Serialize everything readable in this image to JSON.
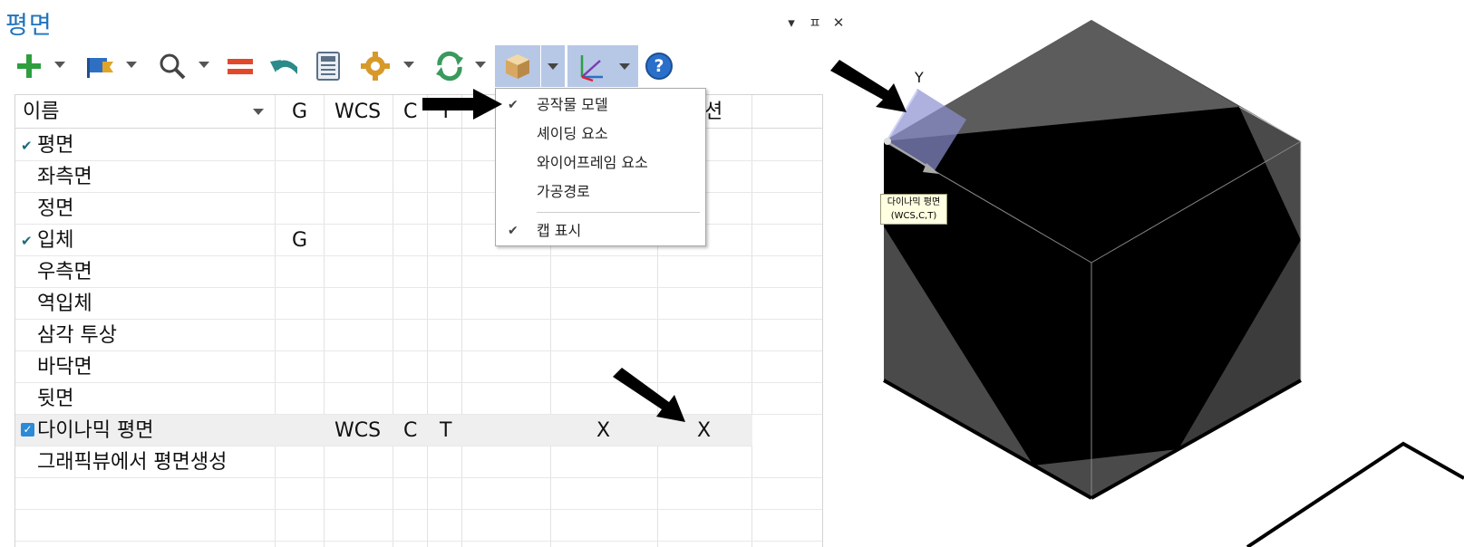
{
  "panel": {
    "title": "평면",
    "controls": {
      "dropdown": "▾",
      "pin": "ㅍ",
      "close": "✕"
    }
  },
  "toolbar": {
    "icons": [
      "add-icon",
      "flag-icon",
      "search-icon",
      "equal-icon",
      "undo-icon",
      "calculator-icon",
      "gear-icon",
      "refresh-icon",
      "cube-icon",
      "axes-icon",
      "help-icon"
    ],
    "help_label": "?"
  },
  "grid": {
    "columns": [
      "이름",
      "G",
      "WCS",
      "C",
      "T",
      "",
      "",
      "션"
    ],
    "rows": [
      {
        "checked": true,
        "checkbox": false,
        "name": "평면",
        "g": "",
        "wcs": "",
        "c": "",
        "t": "",
        "x1": "",
        "x2": ""
      },
      {
        "checked": false,
        "checkbox": false,
        "name": "좌측면",
        "g": "",
        "wcs": "",
        "c": "",
        "t": "",
        "x1": "",
        "x2": ""
      },
      {
        "checked": false,
        "checkbox": false,
        "name": "정면",
        "g": "",
        "wcs": "",
        "c": "",
        "t": "",
        "x1": "",
        "x2": ""
      },
      {
        "checked": true,
        "checkbox": false,
        "name": "입체",
        "g": "G",
        "wcs": "",
        "c": "",
        "t": "",
        "x1": "",
        "x2": ""
      },
      {
        "checked": false,
        "checkbox": false,
        "name": "우측면",
        "g": "",
        "wcs": "",
        "c": "",
        "t": "",
        "x1": "",
        "x2": ""
      },
      {
        "checked": false,
        "checkbox": false,
        "name": "역입체",
        "g": "",
        "wcs": "",
        "c": "",
        "t": "",
        "x1": "",
        "x2": ""
      },
      {
        "checked": false,
        "checkbox": false,
        "name": "삼각 투상",
        "g": "",
        "wcs": "",
        "c": "",
        "t": "",
        "x1": "",
        "x2": ""
      },
      {
        "checked": false,
        "checkbox": false,
        "name": "바닥면",
        "g": "",
        "wcs": "",
        "c": "",
        "t": "",
        "x1": "",
        "x2": ""
      },
      {
        "checked": false,
        "checkbox": false,
        "name": "뒷면",
        "g": "",
        "wcs": "",
        "c": "",
        "t": "",
        "x1": "",
        "x2": ""
      },
      {
        "checked": false,
        "checkbox": true,
        "name": "다이나믹 평면",
        "g": "",
        "wcs": "WCS",
        "c": "C",
        "t": "T",
        "x1": "X",
        "x2": "X"
      },
      {
        "checked": false,
        "checkbox": false,
        "name": "그래픽뷰에서 평면생성",
        "g": "",
        "wcs": "",
        "c": "",
        "t": "",
        "x1": "",
        "x2": ""
      },
      {
        "checked": false,
        "checkbox": false,
        "name": "",
        "g": "",
        "wcs": "",
        "c": "",
        "t": "",
        "x1": "",
        "x2": ""
      },
      {
        "checked": false,
        "checkbox": false,
        "name": "",
        "g": "",
        "wcs": "",
        "c": "",
        "t": "",
        "x1": "",
        "x2": ""
      }
    ]
  },
  "menu": {
    "items": [
      {
        "label": "공작물 모델",
        "checked": true
      },
      {
        "label": "셰이딩 요소",
        "checked": false
      },
      {
        "label": "와이어프레임 요소",
        "checked": false
      },
      {
        "label": "가공경로",
        "checked": false
      },
      {
        "label": "캡 표시",
        "checked": true
      }
    ],
    "check_glyph": "✔"
  },
  "viewport": {
    "axis_label": "Y",
    "tooltip_line1": "다이나믹 평면",
    "tooltip_line2": "(WCS,C,T)"
  },
  "colors": {
    "accent": "#1e73be",
    "selected_tool": "#b7c7e6",
    "check": "#1b6b7a"
  }
}
